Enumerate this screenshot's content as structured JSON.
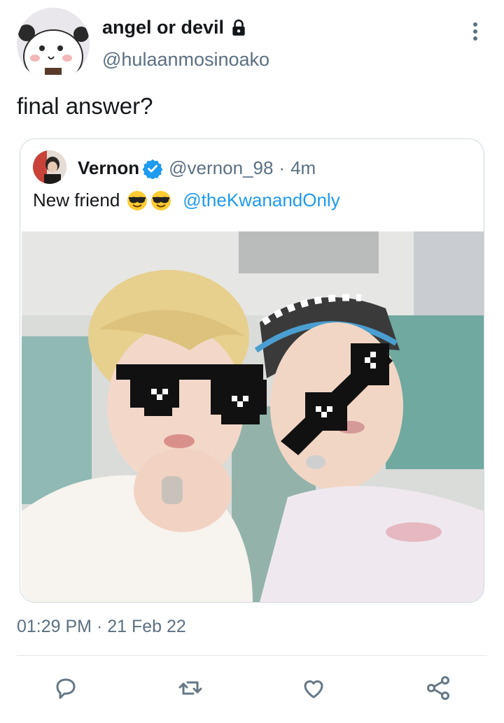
{
  "tweet": {
    "display_name": "angel or devil",
    "handle": "@hulaanmosinoako",
    "text": "final answer?",
    "timestamp": "01:29 PM · 21 Feb 22"
  },
  "quoted_tweet": {
    "name": "Vernon",
    "handle": "@vernon_98",
    "separator": "·",
    "time": "4m",
    "text": "New friend",
    "emojis": [
      "sunglasses-emoji",
      "sunglasses-emoji"
    ],
    "mention": "@theKwanandOnly"
  },
  "icons": {
    "account": "lock-icon",
    "menu": "more-vertical-icon",
    "verified": "verified-badge-icon",
    "actions": [
      "reply-icon",
      "retweet-icon",
      "like-icon",
      "share-icon"
    ]
  },
  "colors": {
    "link": "#1d9bf0",
    "secondary_text": "#5b7083",
    "icon": "#657786",
    "border": "#cfd9de"
  }
}
